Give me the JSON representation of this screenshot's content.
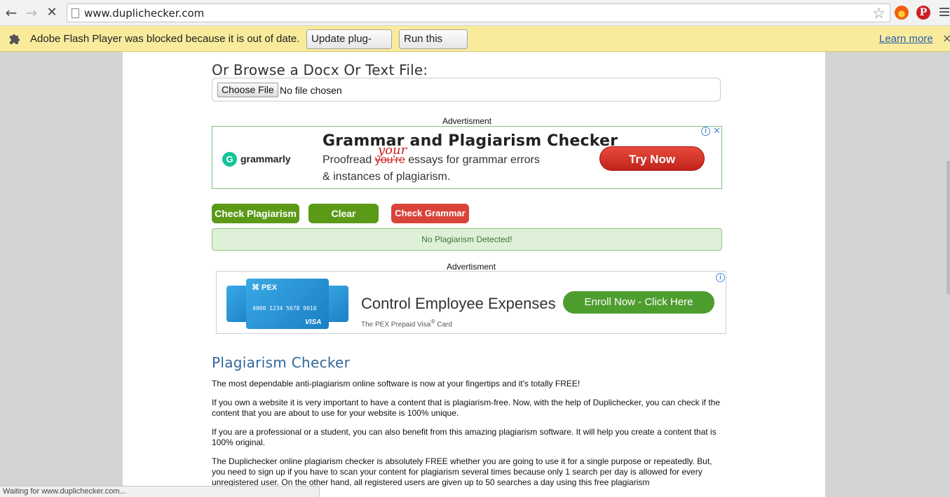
{
  "browser": {
    "url": "www.duplichecker.com"
  },
  "infobar": {
    "message": "Adobe Flash Player was blocked because it is out of date.",
    "update_label": "Update plug-in...",
    "run_label": "Run this time",
    "learn_more": "Learn more",
    "close_glyph": "×"
  },
  "upload": {
    "heading": "Or Browse a Docx Or Text File:",
    "button_label": "Choose File",
    "status": "No file chosen"
  },
  "ad_label": "Advertisment",
  "ad_grammarly": {
    "brand": "grammarly",
    "brand_glyph": "G",
    "title": "Grammar and Plagiarism Checker",
    "line1_a": "Proofread ",
    "line1_strike": "you're",
    "line1_b": " essays for grammar errors",
    "correction": "your",
    "line2": "& instances of plagiarism.",
    "cta": "Try Now"
  },
  "actions": {
    "check_plagiarism": "Check Plagiarism",
    "clear": "Clear",
    "check_grammar": "Check Grammar"
  },
  "result": "No Plagiarism Detected!",
  "ad_pex": {
    "card_logo": "⌘ PEX",
    "card_number": "4000 1234 5678 9010",
    "card_network": "VISA",
    "title": "Control Employee Expenses",
    "subtitle_a": "The PEX Prepaid Visa",
    "subtitle_reg": "®",
    "subtitle_b": " Card",
    "cta": "Enroll Now - Click Here"
  },
  "article": {
    "title": "Plagiarism Checker",
    "p1": "The most dependable anti-plagiarism online software is now at your fingertips and it's totally FREE!",
    "p2": "If you own a website it is very important to have a content that is plagiarism-free. Now, with the help of Duplichecker, you can check if the content that you are about to use for your website is 100% unique.",
    "p3": "If you are a professional or a student, you can also benefit from this amazing plagiarism software. It will help you create a content that is 100% original.",
    "p4": "The Duplichecker online plagiarism checker is absolutely FREE whether you are going to use it for a single purpose or repeatedly. But, you need to sign up if you have to scan your content for plagiarism several times because only 1 search per day is allowed for every unregistered user. On the other hand, all registered users are given up to 50 searches a day using this free plagiarism"
  },
  "status_bar": "Waiting for www.duplichecker.com...",
  "colors": {
    "infobar_bg": "#f8eb9c",
    "green_button": "#5b9a17",
    "red_button": "#d9443a",
    "success_bg": "#dff0d8",
    "heading_blue": "#336699"
  }
}
